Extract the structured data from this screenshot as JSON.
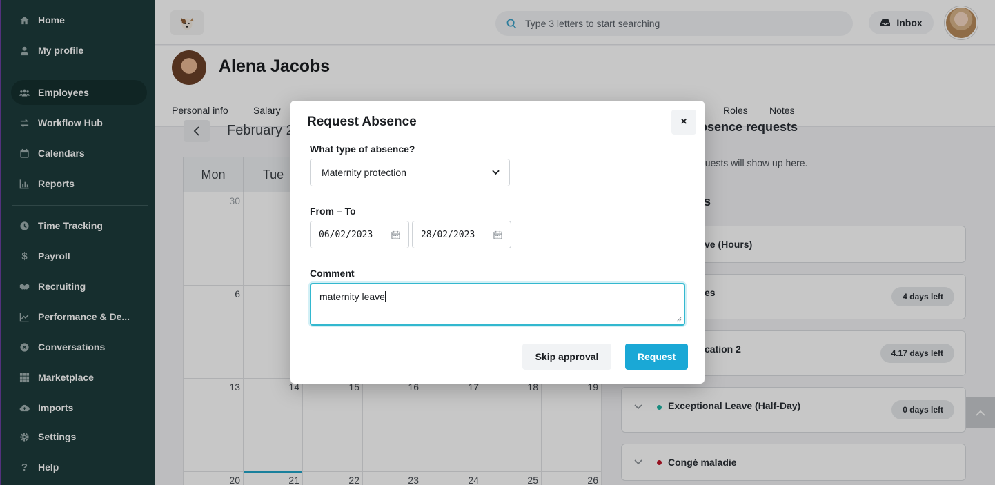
{
  "app": {
    "colors": {
      "sidebar": "#1d3c3c",
      "accent": "#1aa8d6",
      "focus": "#33b8cf"
    }
  },
  "sidebar": {
    "items": [
      {
        "label": "Home",
        "icon": "home-icon"
      },
      {
        "label": "My profile",
        "icon": "person-icon"
      },
      {
        "label": "Employees",
        "icon": "people-icon",
        "active": true
      },
      {
        "label": "Workflow Hub",
        "icon": "workflow-icon"
      },
      {
        "label": "Calendars",
        "icon": "calendar-icon"
      },
      {
        "label": "Reports",
        "icon": "chart-icon"
      },
      {
        "label": "Time Tracking",
        "icon": "clock-icon"
      },
      {
        "label": "Payroll",
        "icon": "dollar-icon"
      },
      {
        "label": "Recruiting",
        "icon": "handshake-icon"
      },
      {
        "label": "Performance & De...",
        "icon": "trend-icon"
      },
      {
        "label": "Conversations",
        "icon": "chat-icon"
      },
      {
        "label": "Marketplace",
        "icon": "grid-icon"
      },
      {
        "label": "Imports",
        "icon": "cloud-icon"
      },
      {
        "label": "Settings",
        "icon": "gear-icon"
      },
      {
        "label": "Help",
        "icon": "help-icon"
      }
    ]
  },
  "header": {
    "search_placeholder": "Type 3 letters to start searching",
    "inbox_label": "Inbox"
  },
  "employee": {
    "name": "Alena Jacobs"
  },
  "tabs": {
    "personal_info": "Personal info",
    "salary": "Salary",
    "roles": "Roles",
    "notes": "Notes"
  },
  "calendar": {
    "month_title": "February 2",
    "weekday_headers": [
      "Mon",
      "Tue"
    ],
    "row1": [
      "30"
    ],
    "row2": [
      "6"
    ],
    "row3": [
      "13",
      "14",
      "15",
      "16",
      "17",
      "18",
      "19"
    ],
    "row4": [
      "20",
      "21",
      "22",
      "23",
      "24",
      "25",
      "26"
    ]
  },
  "panel": {
    "requests_title": "bsence requests",
    "requests_text": "quests will show up here.",
    "balances_title": "s",
    "cards": [
      {
        "label": "ve (Hours)",
        "pill": ""
      },
      {
        "label": "es",
        "pill": "4 days left"
      },
      {
        "label": "cation 2",
        "pill": "4.17 days left"
      },
      {
        "label": "Exceptional Leave (Half-Day)",
        "pill": "0 days left",
        "dot_color": "#21b5a5"
      },
      {
        "label": "Congé maladie",
        "pill": "",
        "dot_color": "#c0182b"
      }
    ]
  },
  "modal": {
    "title": "Request Absence",
    "close_label": "×",
    "type_label": "What type of absence?",
    "type_value": "Maternity protection",
    "range_label": "From – To",
    "from_value": "06/02/2023",
    "to_value": "28/02/2023",
    "comment_label": "Comment",
    "comment_value": "maternity leave",
    "skip_label": "Skip approval",
    "request_label": "Request"
  }
}
